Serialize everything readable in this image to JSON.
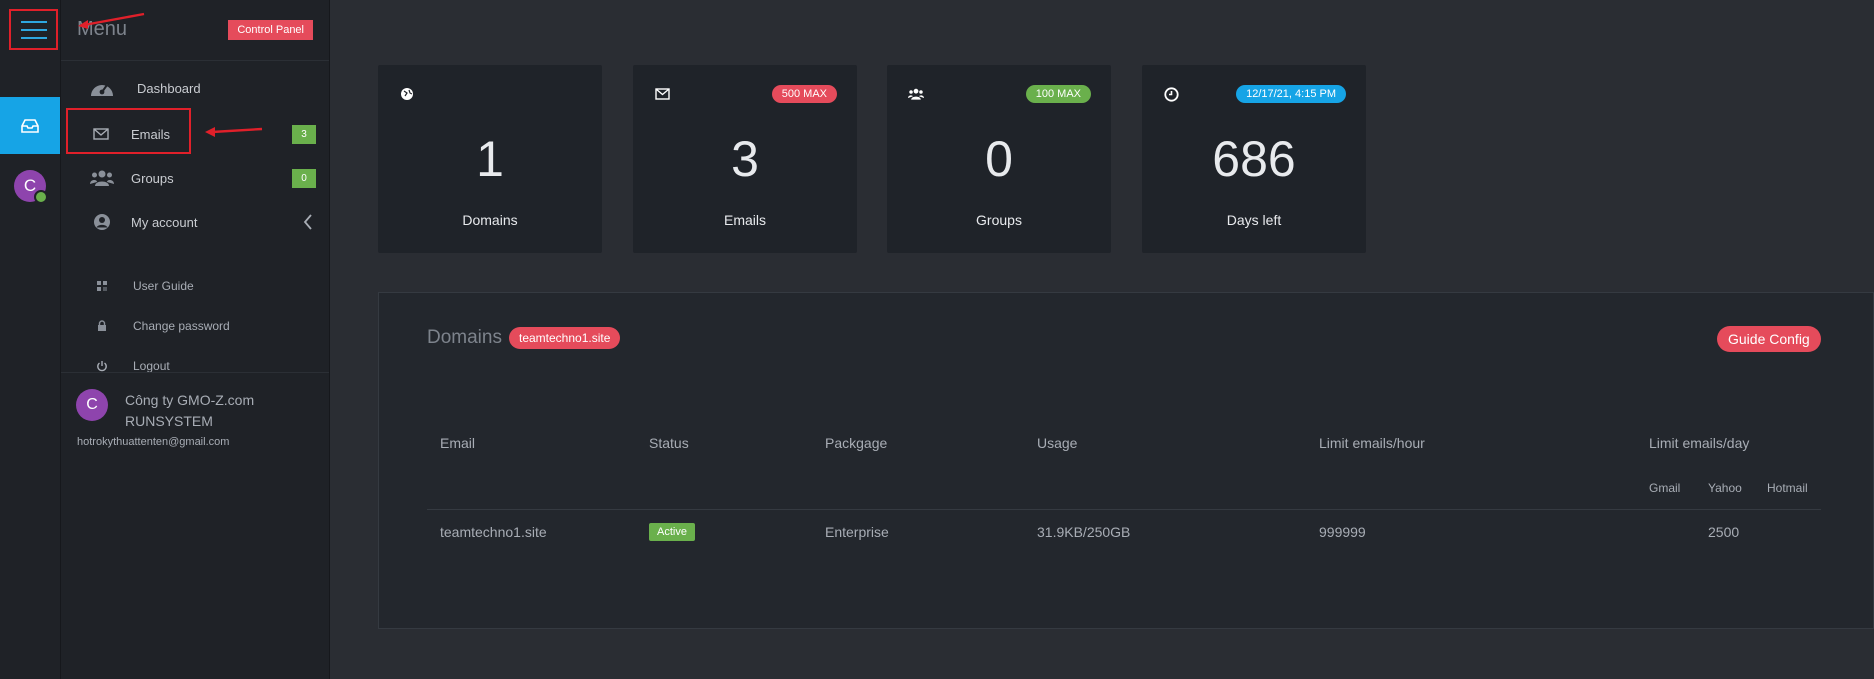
{
  "menu": {
    "title": "Menu",
    "control_panel_label": "Control Panel",
    "items": [
      {
        "label": "Dashboard",
        "icon": "dashboard-icon"
      },
      {
        "label": "Emails",
        "icon": "mail-icon",
        "badge": "3"
      },
      {
        "label": "Groups",
        "icon": "users-icon",
        "badge": "0"
      },
      {
        "label": "My account",
        "icon": "user-circle-icon"
      }
    ],
    "sub_items": [
      {
        "label": "User Guide",
        "icon": "guide-icon"
      },
      {
        "label": "Change password",
        "icon": "lock-icon"
      },
      {
        "label": "Logout",
        "icon": "power-icon"
      }
    ]
  },
  "user": {
    "initial": "C",
    "company_line1": "Công ty GMO-Z.com",
    "company_line2": "RUNSYSTEM",
    "email": "hotrokythuattenten@gmail.com"
  },
  "cards": [
    {
      "value": "1",
      "label": "Domains",
      "icon": "globe-icon",
      "badge": ""
    },
    {
      "value": "3",
      "label": "Emails",
      "icon": "mail-icon",
      "badge": "500 MAX",
      "badge_color": "#e54b5b"
    },
    {
      "value": "0",
      "label": "Groups",
      "icon": "users-icon",
      "badge": "100 MAX",
      "badge_color": "#6ab04c"
    },
    {
      "value": "686",
      "label": "Days left",
      "icon": "clock-icon",
      "badge": "12/17/21, 4:15 PM",
      "badge_color": "#16a4e6"
    }
  ],
  "domains_panel": {
    "title": "Domains",
    "domain_badge": "teamtechno1.site",
    "guide_button": "Guide Config",
    "columns": [
      "Email",
      "Status",
      "Packgage",
      "Usage",
      "Limit emails/hour",
      "Limit emails/day"
    ],
    "day_subcolumns": [
      "Gmail",
      "Yahoo",
      "Hotmail"
    ],
    "rows": [
      {
        "email": "teamtechno1.site",
        "status": "Active",
        "package": "Enterprise",
        "usage": "31.9KB/250GB",
        "limit_hour": "999999",
        "limit_day_yahoo": "2500"
      }
    ]
  },
  "colors": {
    "accent": "#16a4e6",
    "danger": "#e54b5b",
    "success": "#6ab04c"
  }
}
